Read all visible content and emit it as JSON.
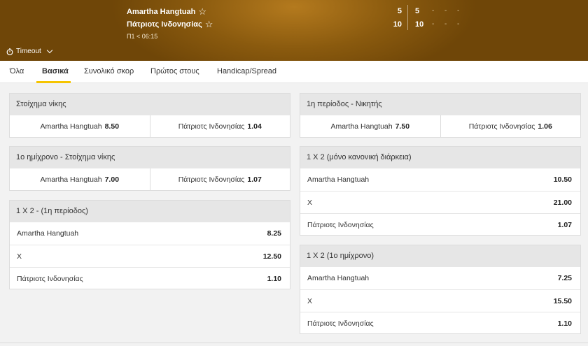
{
  "event": {
    "team1": "Amartha Hangtuah",
    "team2": "Πάτριοτς Ινδονησίας",
    "period": "Π1 < 06:15",
    "score1": "5",
    "score2": "10",
    "q1_team1": "5",
    "q1_team2": "10",
    "empty": "-",
    "timeout_label": "Timeout"
  },
  "tabs": [
    "Όλα",
    "Βασικά",
    "Συνολικό σκορ",
    "Πρώτος στους",
    "Handicap/Spread"
  ],
  "markets": {
    "winner": {
      "title": "Στοίχημα νίκης",
      "options": [
        {
          "label": "Amartha Hangtuah",
          "odd": "8.50"
        },
        {
          "label": "Πάτριοτς Ινδονησίας",
          "odd": "1.04"
        }
      ]
    },
    "first_half_winner": {
      "title": "1ο ημίχρονο - Στοίχημα νίκης",
      "options": [
        {
          "label": "Amartha Hangtuah",
          "odd": "7.00"
        },
        {
          "label": "Πάτριοτς Ινδονησίας",
          "odd": "1.07"
        }
      ]
    },
    "period1_1x2": {
      "title": "1 X 2 - (1η περίοδος)",
      "options": [
        {
          "label": "Amartha Hangtuah",
          "odd": "8.25"
        },
        {
          "label": "X",
          "odd": "12.50"
        },
        {
          "label": "Πάτριοτς Ινδονησίας",
          "odd": "1.10"
        }
      ]
    },
    "period1_winner": {
      "title": "1η περίοδος - Νικητής",
      "options": [
        {
          "label": "Amartha Hangtuah",
          "odd": "7.50"
        },
        {
          "label": "Πάτριοτς Ινδονησίας",
          "odd": "1.06"
        }
      ]
    },
    "regular_1x2": {
      "title": "1 X 2 (μόνο κανονική διάρκεια)",
      "options": [
        {
          "label": "Amartha Hangtuah",
          "odd": "10.50"
        },
        {
          "label": "X",
          "odd": "21.00"
        },
        {
          "label": "Πάτριοτς Ινδονησίας",
          "odd": "1.07"
        }
      ]
    },
    "half1_1x2": {
      "title": "1 X 2 (1ο ημίχρονο)",
      "options": [
        {
          "label": "Amartha Hangtuah",
          "odd": "7.25"
        },
        {
          "label": "X",
          "odd": "15.50"
        },
        {
          "label": "Πάτριοτς Ινδονησίας",
          "odd": "1.10"
        }
      ]
    }
  }
}
